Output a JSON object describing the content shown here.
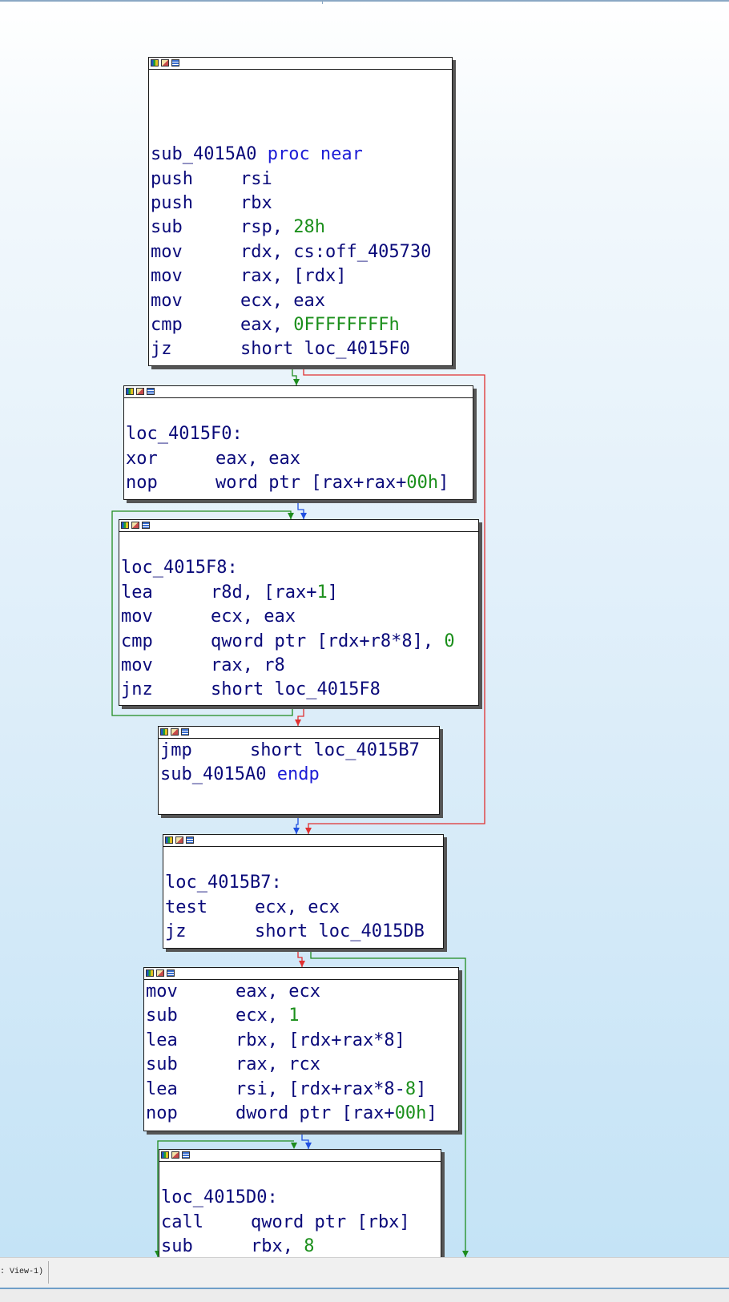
{
  "view_name": "View-1",
  "status": {
    "label": ": View-1)"
  },
  "header_icons": [
    "graph-icon",
    "edit-icon",
    "list-icon"
  ],
  "colors": {
    "edge_true": "#1e8c1e",
    "edge_false": "#e03030",
    "edge_uncond": "#2050e0",
    "background_top": "#ffffff",
    "background_bottom": "#c4e3f6"
  },
  "nodes": [
    {
      "lines": [
        [],
        [],
        [],
        [
          {
            "t": "sub_4015A0 ",
            "c": ""
          },
          {
            "t": "proc near",
            "c": "kw"
          }
        ],
        [
          {
            "t": "push",
            "c": "",
            "m": 1
          },
          {
            "t": "rsi",
            "c": ""
          }
        ],
        [
          {
            "t": "push",
            "c": "",
            "m": 1
          },
          {
            "t": "rbx",
            "c": ""
          }
        ],
        [
          {
            "t": "sub",
            "c": "",
            "m": 1
          },
          {
            "t": "rsp, ",
            "c": ""
          },
          {
            "t": "28h",
            "c": "num"
          }
        ],
        [
          {
            "t": "mov",
            "c": "",
            "m": 1
          },
          {
            "t": "rdx, cs:off_405730",
            "c": ""
          }
        ],
        [
          {
            "t": "mov",
            "c": "",
            "m": 1
          },
          {
            "t": "rax, [rdx]",
            "c": ""
          }
        ],
        [
          {
            "t": "mov",
            "c": "",
            "m": 1
          },
          {
            "t": "ecx, eax",
            "c": ""
          }
        ],
        [
          {
            "t": "cmp",
            "c": "",
            "m": 1
          },
          {
            "t": "eax, ",
            "c": ""
          },
          {
            "t": "0FFFFFFFFh",
            "c": "num"
          }
        ],
        [
          {
            "t": "jz",
            "c": "",
            "m": 1
          },
          {
            "t": "short loc_4015F0",
            "c": ""
          }
        ]
      ]
    },
    {
      "lines": [
        [],
        [
          {
            "t": "loc_4015F0:",
            "c": ""
          }
        ],
        [
          {
            "t": "xor",
            "c": "",
            "m": 1
          },
          {
            "t": "eax, eax",
            "c": ""
          }
        ],
        [
          {
            "t": "nop",
            "c": "",
            "m": 1
          },
          {
            "t": "word ptr [rax+rax+",
            "c": ""
          },
          {
            "t": "00h",
            "c": "num"
          },
          {
            "t": "]",
            "c": ""
          }
        ]
      ]
    },
    {
      "lines": [
        [],
        [
          {
            "t": "loc_4015F8:",
            "c": ""
          }
        ],
        [
          {
            "t": "lea",
            "c": "",
            "m": 1
          },
          {
            "t": "r8d, [rax+",
            "c": ""
          },
          {
            "t": "1",
            "c": "num"
          },
          {
            "t": "]",
            "c": ""
          }
        ],
        [
          {
            "t": "mov",
            "c": "",
            "m": 1
          },
          {
            "t": "ecx, eax",
            "c": ""
          }
        ],
        [
          {
            "t": "cmp",
            "c": "",
            "m": 1
          },
          {
            "t": "qword ptr [rdx+r8*8], ",
            "c": ""
          },
          {
            "t": "0",
            "c": "num"
          }
        ],
        [
          {
            "t": "mov",
            "c": "",
            "m": 1
          },
          {
            "t": "rax, r8",
            "c": ""
          }
        ],
        [
          {
            "t": "jnz",
            "c": "",
            "m": 1
          },
          {
            "t": "short loc_4015F8",
            "c": ""
          }
        ]
      ]
    },
    {
      "lines": [
        [
          {
            "t": "jmp",
            "c": "",
            "m": 1
          },
          {
            "t": "short loc_4015B7",
            "c": ""
          }
        ],
        [
          {
            "t": "sub_4015A0 ",
            "c": ""
          },
          {
            "t": "endp",
            "c": "kw"
          }
        ]
      ]
    },
    {
      "lines": [
        [],
        [
          {
            "t": "loc_4015B7:",
            "c": ""
          }
        ],
        [
          {
            "t": "test",
            "c": "",
            "m": 1
          },
          {
            "t": "ecx, ecx",
            "c": ""
          }
        ],
        [
          {
            "t": "jz",
            "c": "",
            "m": 1
          },
          {
            "t": "short loc_4015DB",
            "c": ""
          }
        ]
      ]
    },
    {
      "lines": [
        [
          {
            "t": "mov",
            "c": "",
            "m": 1
          },
          {
            "t": "eax, ecx",
            "c": ""
          }
        ],
        [
          {
            "t": "sub",
            "c": "",
            "m": 1
          },
          {
            "t": "ecx, ",
            "c": ""
          },
          {
            "t": "1",
            "c": "num"
          }
        ],
        [
          {
            "t": "lea",
            "c": "",
            "m": 1
          },
          {
            "t": "rbx, [rdx+rax*8]",
            "c": ""
          }
        ],
        [
          {
            "t": "sub",
            "c": "",
            "m": 1
          },
          {
            "t": "rax, rcx",
            "c": ""
          }
        ],
        [
          {
            "t": "lea",
            "c": "",
            "m": 1
          },
          {
            "t": "rsi, [rdx+rax*8-",
            "c": ""
          },
          {
            "t": "8",
            "c": "num"
          },
          {
            "t": "]",
            "c": ""
          }
        ],
        [
          {
            "t": "nop",
            "c": "",
            "m": 1
          },
          {
            "t": "dword ptr [rax+",
            "c": ""
          },
          {
            "t": "00h",
            "c": "num"
          },
          {
            "t": "]",
            "c": ""
          }
        ]
      ]
    },
    {
      "lines": [
        [],
        [
          {
            "t": "loc_4015D0:",
            "c": ""
          }
        ],
        [
          {
            "t": "call",
            "c": "",
            "m": 1
          },
          {
            "t": "qword ptr [rbx]",
            "c": ""
          }
        ],
        [
          {
            "t": "sub",
            "c": "",
            "m": 1
          },
          {
            "t": "rbx, ",
            "c": ""
          },
          {
            "t": "8",
            "c": "num"
          }
        ]
      ]
    }
  ]
}
